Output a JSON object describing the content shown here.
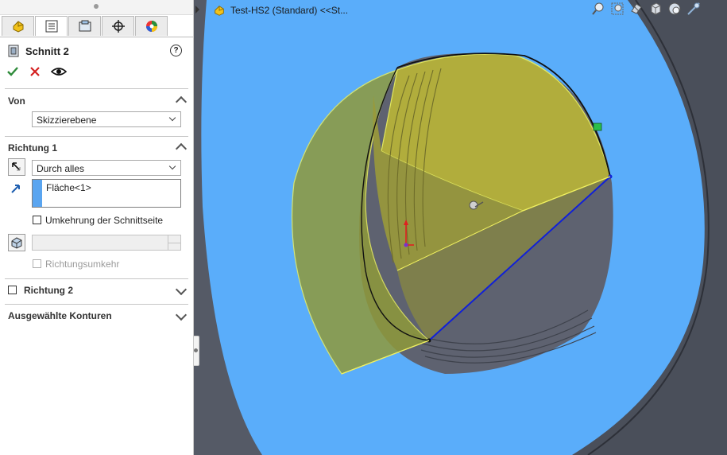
{
  "feature": {
    "title": "Schnitt 2",
    "help_label": "?"
  },
  "tabs": [
    {
      "icon": "feature-manager-icon"
    },
    {
      "icon": "property-manager-icon"
    },
    {
      "icon": "configuration-manager-icon"
    },
    {
      "icon": "dimxpert-icon"
    },
    {
      "icon": "display-manager-icon"
    }
  ],
  "actions": {
    "ok_icon": "checkmark-icon",
    "cancel_icon": "x-icon",
    "preview_icon": "eye-icon"
  },
  "von": {
    "label": "Von",
    "value": "Skizzierebene"
  },
  "richtung1": {
    "label": "Richtung 1",
    "end_condition": "Durch alles",
    "face": "Fläche<1>",
    "flip_side_label": "Umkehrung der Schnittseite",
    "direction_reverse_label": "Richtungsumkehr"
  },
  "richtung2": {
    "label": "Richtung 2"
  },
  "contours": {
    "label": "Ausgewählte Konturen"
  },
  "document": {
    "title": "Test-HS2  (Standard) <<St..."
  },
  "colors": {
    "viewport_bg": "#5aadfa",
    "preview_yellow": "#b3b33a",
    "ok_green": "#2e8b3a",
    "cancel_red": "#d42020"
  }
}
